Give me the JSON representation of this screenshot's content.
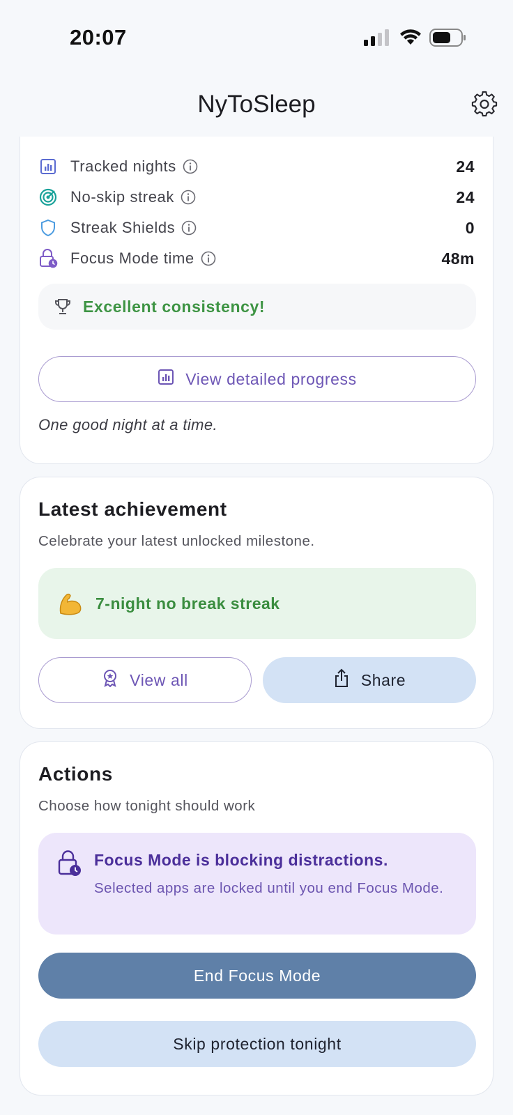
{
  "status_bar": {
    "time": "20:07",
    "icons": [
      "cellular-signal-icon",
      "wifi-icon",
      "battery-icon"
    ]
  },
  "header": {
    "title": "NyToSleep",
    "settings_icon": "gear-icon"
  },
  "stats": {
    "rows": [
      {
        "label": "Tracked nights",
        "value": "24",
        "icon": "bar-chart-icon",
        "color": "#5b6bd1"
      },
      {
        "label": "No-skip streak",
        "value": "24",
        "icon": "target-icon",
        "color": "#1aa29a"
      },
      {
        "label": "Streak Shields",
        "value": "0",
        "icon": "shield-icon",
        "color": "#4a9be0"
      },
      {
        "label": "Focus Mode time",
        "value": "48m",
        "icon": "lock-clock-icon",
        "color": "#7e5cc7"
      }
    ],
    "consistency_text": "Excellent consistency!",
    "view_progress_label": "View detailed progress",
    "motto": "One good night at a time."
  },
  "achievement": {
    "title": "Latest achievement",
    "subtitle": "Celebrate your latest unlocked milestone.",
    "badge_emoji": "💪",
    "badge_text": "7-night no break streak",
    "view_all_label": "View all",
    "share_label": "Share"
  },
  "actions": {
    "title": "Actions",
    "subtitle": "Choose how tonight should work",
    "focus_title": "Focus Mode is blocking distractions.",
    "focus_desc": "Selected apps are locked until you end Focus Mode.",
    "end_focus_label": "End Focus Mode",
    "skip_label": "Skip protection tonight"
  },
  "colors": {
    "accent_purple": "#6d56b5",
    "success_green": "#3e9444",
    "primary_button": "#5f80a8",
    "secondary_button": "#d3e2f5"
  }
}
